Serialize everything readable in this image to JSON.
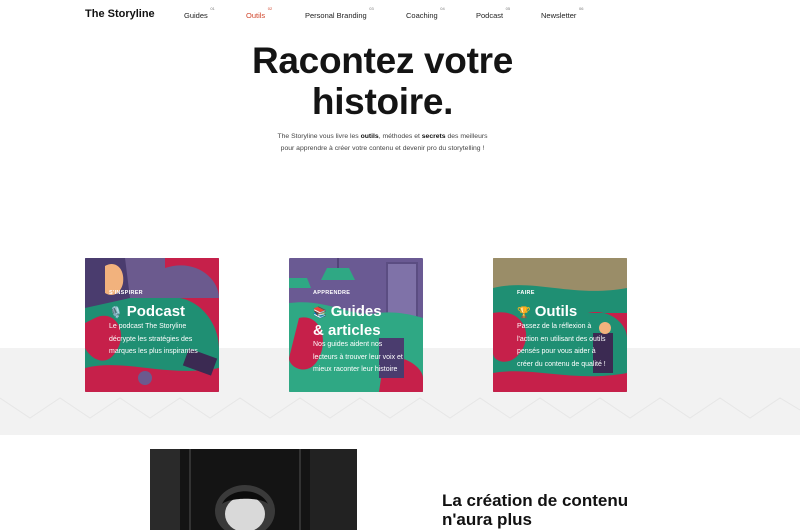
{
  "brand": "The Storyline",
  "nav": [
    {
      "label": "Guides",
      "num": "01"
    },
    {
      "label": "Outils",
      "num": "02"
    },
    {
      "label": "Personal Branding",
      "num": "03"
    },
    {
      "label": "Coaching",
      "num": "04"
    },
    {
      "label": "Podcast",
      "num": "05"
    },
    {
      "label": "Newsletter",
      "num": "06"
    }
  ],
  "hero": {
    "title_line1": "Racontez votre",
    "title_line2": "histoire.",
    "sub_prefix": "The Storyline vous livre les ",
    "sub_b1": "outils",
    "sub_mid": ", méthodes et ",
    "sub_b2": "secrets",
    "sub_suffix": " des meilleurs",
    "sub_line2": "pour apprendre à créer votre contenu et devenir pro du storytelling !"
  },
  "cards": [
    {
      "eyebrow": "S'INSPIRER",
      "emoji": "🎙️",
      "title": "Podcast",
      "title2": "",
      "desc": "Le podcast The Storyline décrypte les stratégies des marques les plus inspirantes"
    },
    {
      "eyebrow": "APPRENDRE",
      "emoji": "📚",
      "title": "Guides",
      "title2": "& articles",
      "desc": "Nos guides aident nos lecteurs à trouver leur voix et mieux raconter leur histoire"
    },
    {
      "eyebrow": "FAIRE",
      "emoji": "🏆",
      "title": "Outils",
      "title2": "",
      "desc": "Passez de la réflexion à l'action en utilisant des outils pensés pour vous aider à créer du contenu de qualité !"
    }
  ],
  "bottom": {
    "title": "La création de contenu n'aura plus"
  },
  "colors": {
    "accent": "#d0452b",
    "card_green": "#2a9d7c",
    "card_purple": "#6a5a93",
    "card_olive": "#8a7d5a"
  }
}
